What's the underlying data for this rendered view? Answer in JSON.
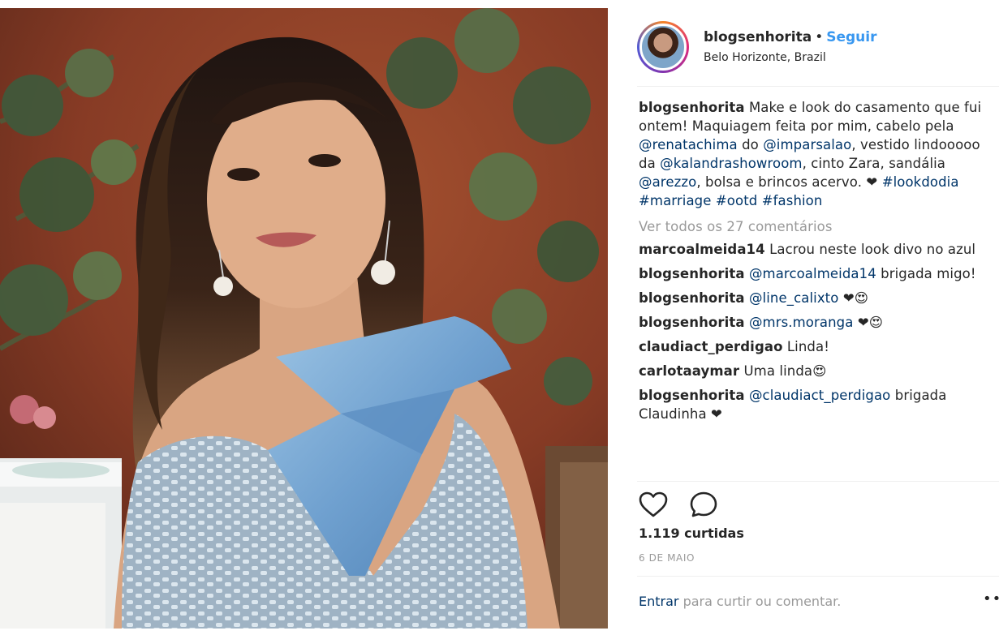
{
  "post": {
    "header": {
      "username": "blogsenhorita",
      "separator": "•",
      "follow_label": "Seguir",
      "location": "Belo Horizonte, Brazil",
      "avatar_icon": "avatar-photo"
    },
    "caption": {
      "username": "blogsenhorita",
      "t1": "Make e look do casamento que fui ontem! Maquiagem feita por mim, cabelo pela ",
      "m1": "@renatachima",
      "t2": " do ",
      "m2": "@imparsalao",
      "t3": ", vestido lindooooo da ",
      "m3": "@kalandrashowroom",
      "t4": ", cinto Zara, sandália ",
      "m4": "@arezzo",
      "t5": ", bolsa e brincos acervo. ❤",
      "h1": "#lookdodia",
      "h2": "#marriage",
      "h3": "#ootd",
      "h4": "#fashion"
    },
    "view_all_comments": "Ver todos os 27 comentários",
    "comments": [
      {
        "username": "marcoalmeida14",
        "text": "Lacrou neste look divo no azul"
      },
      {
        "username": "blogsenhorita",
        "mention": "@marcoalmeida14",
        "text": "brigada migo!"
      },
      {
        "username": "blogsenhorita",
        "mention": "@line_calixto",
        "text": "❤😍"
      },
      {
        "username": "blogsenhorita",
        "mention": "@mrs.moranga",
        "text": "❤😍"
      },
      {
        "username": "claudiact_perdigao",
        "text": "Linda!"
      },
      {
        "username": "carlotaaymar",
        "text": "Uma linda😍"
      },
      {
        "username": "blogsenhorita",
        "mention": "@claudiact_perdigao",
        "text": "brigada Claudinha ❤"
      }
    ],
    "actions": {
      "like_icon": "heart-outline-icon",
      "comment_icon": "comment-bubble-icon"
    },
    "likes": "1.119 curtidas",
    "date": "6 DE MAIO",
    "login_link": "Entrar",
    "login_text": " para curtir ou comentar.",
    "more_label": "•••"
  },
  "colors": {
    "link_blue": "#3897f0",
    "mention_blue": "#003569",
    "muted_gray": "#999999",
    "text": "#262626"
  }
}
